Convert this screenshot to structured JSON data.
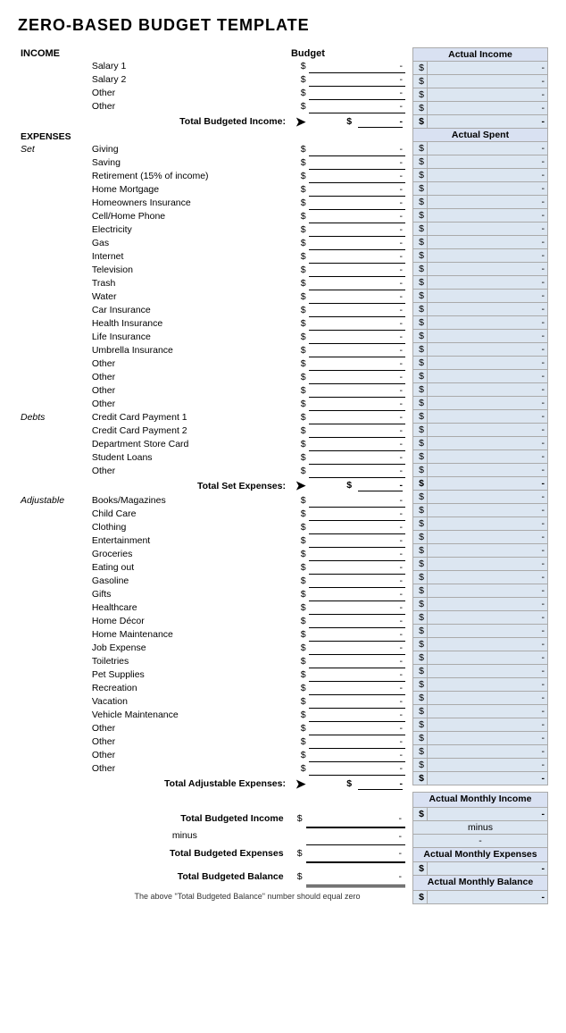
{
  "title": "ZERO-BASED BUDGET TEMPLATE",
  "sections": {
    "income": {
      "label": "INCOME",
      "budget_header": "Budget",
      "actual_income_header": "Actual Income",
      "rows": [
        {
          "name": "Salary 1",
          "dollar": "$",
          "value": "-"
        },
        {
          "name": "Salary 2",
          "dollar": "$",
          "value": "-"
        },
        {
          "name": "Other",
          "dollar": "$",
          "value": "-"
        },
        {
          "name": "Other",
          "dollar": "$",
          "value": "-"
        }
      ],
      "total_label": "Total Budgeted Income:",
      "total_dollar": "$",
      "total_value": "-",
      "right_total_dollar": "$",
      "right_total_value": "-"
    },
    "expenses": {
      "label": "EXPENSES",
      "actual_spent_header": "Actual Spent",
      "set_label": "Set",
      "set_rows": [
        {
          "name": "Giving",
          "dollar": "$",
          "value": "-"
        },
        {
          "name": "Saving",
          "dollar": "$",
          "value": "-"
        },
        {
          "name": "Retirement (15% of income)",
          "dollar": "$",
          "value": "-"
        },
        {
          "name": "Home Mortgage",
          "dollar": "$",
          "value": "-"
        },
        {
          "name": "Homeowners Insurance",
          "dollar": "$",
          "value": "-"
        },
        {
          "name": "Cell/Home Phone",
          "dollar": "$",
          "value": "-"
        },
        {
          "name": "Electricity",
          "dollar": "$",
          "value": "-"
        },
        {
          "name": "Gas",
          "dollar": "$",
          "value": "-"
        },
        {
          "name": "Internet",
          "dollar": "$",
          "value": "-"
        },
        {
          "name": "Television",
          "dollar": "$",
          "value": "-"
        },
        {
          "name": "Trash",
          "dollar": "$",
          "value": "-"
        },
        {
          "name": "Water",
          "dollar": "$",
          "value": "-"
        },
        {
          "name": "Car Insurance",
          "dollar": "$",
          "value": "-"
        },
        {
          "name": "Health Insurance",
          "dollar": "$",
          "value": "-"
        },
        {
          "name": "Life Insurance",
          "dollar": "$",
          "value": "-"
        },
        {
          "name": "Umbrella Insurance",
          "dollar": "$",
          "value": "-"
        },
        {
          "name": "Other",
          "dollar": "$",
          "value": "-"
        },
        {
          "name": "Other",
          "dollar": "$",
          "value": "-"
        },
        {
          "name": "Other",
          "dollar": "$",
          "value": "-"
        },
        {
          "name": "Other",
          "dollar": "$",
          "value": "-"
        }
      ],
      "debts_label": "Debts",
      "debts_rows": [
        {
          "name": "Credit Card Payment 1",
          "dollar": "$",
          "value": "-"
        },
        {
          "name": "Credit Card Payment 2",
          "dollar": "$",
          "value": "-"
        },
        {
          "name": "Department Store Card",
          "dollar": "$",
          "value": "-"
        },
        {
          "name": "Student Loans",
          "dollar": "$",
          "value": "-"
        },
        {
          "name": "Other",
          "dollar": "$",
          "value": "-"
        }
      ],
      "total_set_label": "Total Set Expenses:",
      "total_set_dollar": "$",
      "total_set_value": "-",
      "right_total_set_dollar": "$",
      "right_total_set_value": "-",
      "adjustable_label": "Adjustable",
      "adjustable_rows": [
        {
          "name": "Books/Magazines",
          "dollar": "$",
          "value": "-"
        },
        {
          "name": "Child Care",
          "dollar": "$",
          "value": "-"
        },
        {
          "name": "Clothing",
          "dollar": "$",
          "value": "-"
        },
        {
          "name": "Entertainment",
          "dollar": "$",
          "value": "-"
        },
        {
          "name": "Groceries",
          "dollar": "$",
          "value": "-"
        },
        {
          "name": "Eating out",
          "dollar": "$",
          "value": "-"
        },
        {
          "name": "Gasoline",
          "dollar": "$",
          "value": "-"
        },
        {
          "name": "Gifts",
          "dollar": "$",
          "value": "-"
        },
        {
          "name": "Healthcare",
          "dollar": "$",
          "value": "-"
        },
        {
          "name": "Home Décor",
          "dollar": "$",
          "value": "-"
        },
        {
          "name": "Home Maintenance",
          "dollar": "$",
          "value": "-"
        },
        {
          "name": "Job Expense",
          "dollar": "$",
          "value": "-"
        },
        {
          "name": "Toiletries",
          "dollar": "$",
          "value": "-"
        },
        {
          "name": "Pet Supplies",
          "dollar": "$",
          "value": "-"
        },
        {
          "name": "Recreation",
          "dollar": "$",
          "value": "-"
        },
        {
          "name": "Vacation",
          "dollar": "$",
          "value": "-"
        },
        {
          "name": "Vehicle Maintenance",
          "dollar": "$",
          "value": "-"
        },
        {
          "name": "Other",
          "dollar": "$",
          "value": "-"
        },
        {
          "name": "Other",
          "dollar": "$",
          "value": "-"
        },
        {
          "name": "Other",
          "dollar": "$",
          "value": "-"
        },
        {
          "name": "Other",
          "dollar": "$",
          "value": "-"
        }
      ],
      "total_adj_label": "Total Adjustable Expenses:",
      "total_adj_dollar": "$",
      "total_adj_value": "-",
      "right_total_adj_dollar": "$",
      "right_total_adj_value": "-"
    },
    "summary": {
      "budgeted_income_label": "Total Budgeted Income",
      "budgeted_income_dollar": "$",
      "budgeted_income_value": "-",
      "minus_label": "minus",
      "minus_value": "-",
      "budgeted_expenses_label": "Total Budgeted Expenses",
      "budgeted_expenses_dollar": "$",
      "budgeted_expenses_value": "-",
      "balance_label": "Total Budgeted Balance",
      "balance_dollar": "$",
      "balance_value": "-",
      "footnote": "The above \"Total Budgeted Balance\" number should equal zero",
      "actual_income_label": "Actual Monthly Income",
      "actual_income_dollar": "$",
      "actual_income_value": "-",
      "actual_minus_label": "minus",
      "actual_minus_value": "-",
      "actual_expenses_label": "Actual Monthly Expenses",
      "actual_expenses_dollar": "$",
      "actual_expenses_value": "-",
      "actual_balance_label": "Actual Monthly Balance",
      "actual_balance_dollar": "$",
      "actual_balance_value": "-"
    }
  }
}
